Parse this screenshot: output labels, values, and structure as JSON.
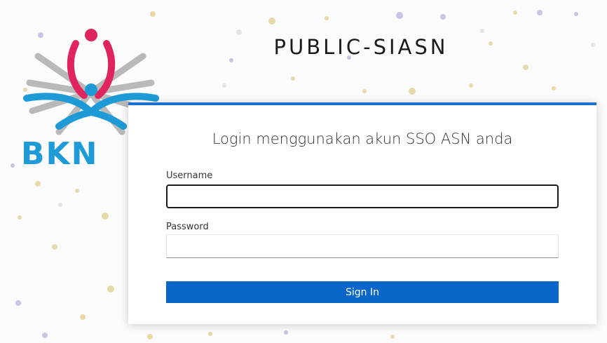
{
  "header": {
    "app_title": "PUBLIC-SIASN",
    "logo_text": "BKN"
  },
  "login": {
    "heading": "Login menggunakan akun SSO ASN anda",
    "username_label": "Username",
    "username_value": "",
    "password_label": "Password",
    "password_value": "",
    "sign_in_label": "Sign In"
  },
  "colors": {
    "accent": "#1f6fd0",
    "button": "#0a66c8",
    "logo_red": "#e0245e",
    "logo_blue": "#1e9bd7",
    "logo_gray": "#b9b9b9"
  }
}
